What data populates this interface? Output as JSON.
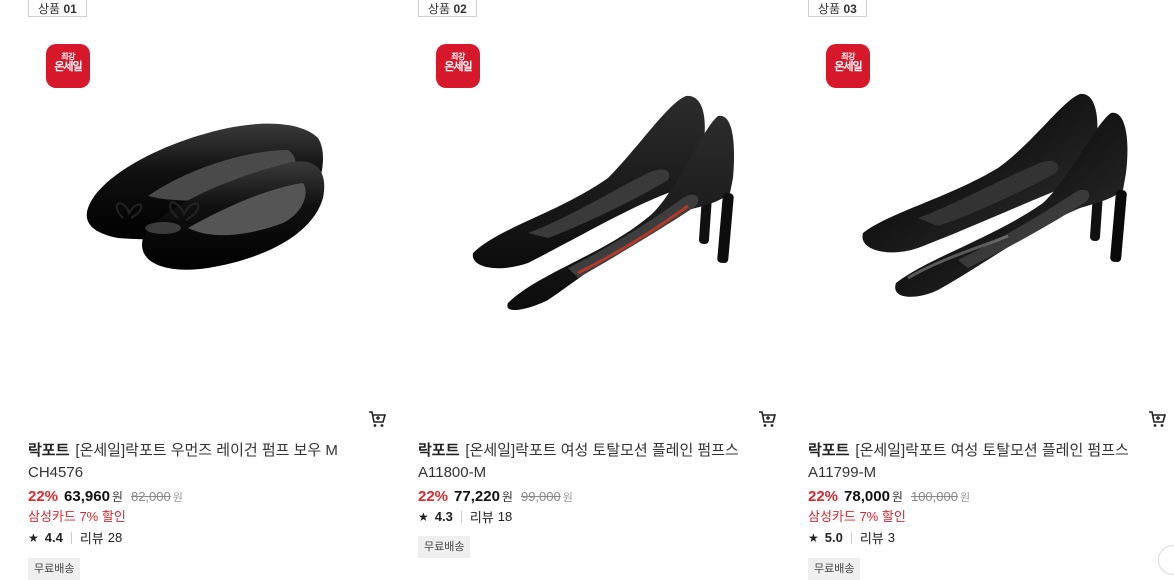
{
  "products": [
    {
      "badge_prefix": "상품",
      "badge_num": "01",
      "sale_badge": {
        "line1": "최강",
        "line2": "온세일"
      },
      "brand": "락포트",
      "name": "[온세일]락포트 우먼즈 레이건 펌프 보우 M CH4576",
      "discount": "22%",
      "price": "63,960",
      "currency": "원",
      "original_price": "82,000",
      "card_promo": "삼성카드 7% 할인",
      "rating": "4.4",
      "review_label": "리뷰",
      "review_count": "28",
      "shipping": "무료배송",
      "image_icon": "ballet-flat-shoe-icon"
    },
    {
      "badge_prefix": "상품",
      "badge_num": "02",
      "sale_badge": {
        "line1": "최강",
        "line2": "온세일"
      },
      "brand": "락포트",
      "name": "[온세일]락포트 여성 토탈모션 플레인 펌프스 A11800-M",
      "discount": "22%",
      "price": "77,220",
      "currency": "원",
      "original_price": "99,000",
      "card_promo": "",
      "rating": "4.3",
      "review_label": "리뷰",
      "review_count": "18",
      "shipping": "무료배송",
      "image_icon": "pump-heel-shoe-icon"
    },
    {
      "badge_prefix": "상품",
      "badge_num": "03",
      "sale_badge": {
        "line1": "최강",
        "line2": "온세일"
      },
      "brand": "락포트",
      "name": "[온세일]락포트 여성 토탈모션 플레인 펌프스 A11799-M",
      "discount": "22%",
      "price": "78,000",
      "currency": "원",
      "original_price": "100,000",
      "card_promo": "삼성카드 7% 할인",
      "rating": "5.0",
      "review_label": "리뷰",
      "review_count": "3",
      "shipping": "무료배송",
      "image_icon": "patent-pump-heel-shoe-icon"
    }
  ],
  "colors": {
    "sale_red": "#d7182a",
    "discount_red": "#e0272b",
    "ship_bg": "#efefef"
  }
}
